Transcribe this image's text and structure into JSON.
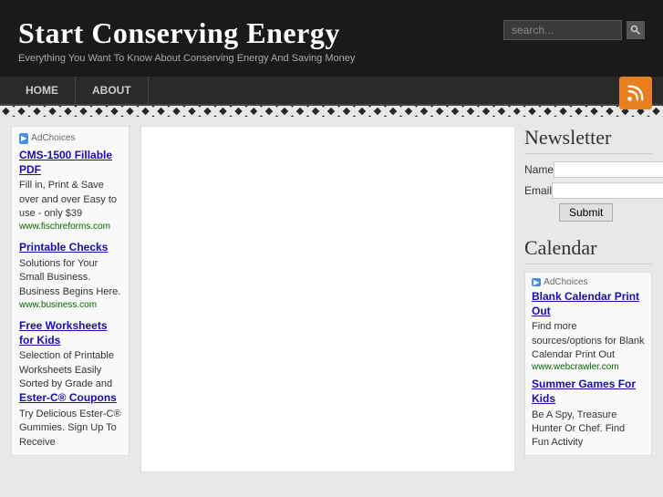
{
  "header": {
    "title": "Start Conserving Energy",
    "tagline": "Everything You Want To Know About Conserving Energy And Saving Money",
    "search_placeholder": "search..."
  },
  "nav": {
    "items": [
      {
        "label": "HOME"
      },
      {
        "label": "ABOUT"
      }
    ]
  },
  "left_ad": {
    "choices_label": "AdChoices",
    "items": [
      {
        "title": "CMS-1500 Fillable PDF",
        "text": "Fill in, Print & Save over and over Easy to use - only $39",
        "url": "www.fischreforms.com"
      },
      {
        "title": "Printable Checks",
        "text": "Solutions for Your Small Business. Business Begins Here.",
        "url": "www.business.com"
      },
      {
        "title": "Free Worksheets for Kids",
        "text": "Selection of Printable Worksheets Easily Sorted by Grade and",
        "url": ""
      },
      {
        "title": "Ester-C® Coupons",
        "text": "Try Delicious Ester-C® Gummies. Sign Up To Receive",
        "url": ""
      }
    ]
  },
  "right_sidebar": {
    "newsletter": {
      "title": "Newsletter",
      "name_label": "Name",
      "email_label": "Email",
      "submit_label": "Submit"
    },
    "calendar": {
      "title": "Calendar",
      "choices_label": "AdChoices",
      "items": [
        {
          "title": "Blank Calendar Print Out",
          "text": "Find more sources/options for Blank Calendar Print Out",
          "url": "www.webcrawler.com"
        },
        {
          "title": "Summer Games For Kids",
          "text": "Be A Spy, Treasure Hunter Or Chef. Find Fun Activity"
        }
      ]
    }
  }
}
